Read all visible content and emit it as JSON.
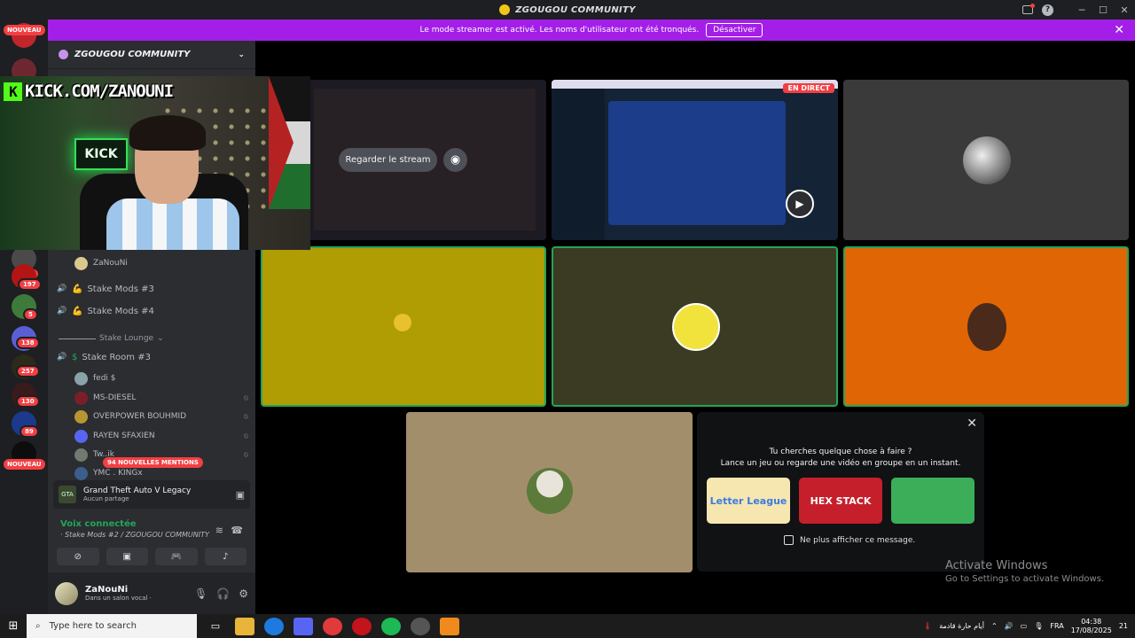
{
  "window": {
    "title": "ZGOUGOU COMMUNITY",
    "minimize": "─",
    "maximize": "☐",
    "close": "✕"
  },
  "banner": {
    "text": "Le mode streamer est activé. Les noms d'utilisateur ont été tronqués.",
    "button": "Désactiver",
    "close": "✕"
  },
  "rail": {
    "new_top": "NOUVEAU",
    "new_bottom": "NOUVEAU",
    "badges": [
      "9",
      "197",
      "5",
      "138",
      "257",
      "130",
      "89"
    ]
  },
  "sidebar": {
    "server_name": "ZGOUGOU COMMUNITY",
    "channels": [
      {
        "name": "Stake Mods #3",
        "emoji": "💪"
      },
      {
        "name": "Stake Mods #4",
        "emoji": "💪"
      }
    ],
    "category": "Stake Lounge",
    "room": {
      "name": "Stake Room #3",
      "prefix": "$"
    },
    "users_top": [
      "ZaNouNi"
    ],
    "users": [
      "fedi $",
      "MS-DIESEL",
      "OVERPOWER BOUHMID",
      "RAYEN SFAXIEN",
      "Tw..ik",
      "YMC . KINGx"
    ],
    "mentions": "94 NOUVELLES MENTIONS"
  },
  "activity": {
    "game": "Grand Theft Auto V Legacy",
    "sub": "Aucun partage",
    "icon": "GTA"
  },
  "voice": {
    "status": "Voix connectée",
    "location": "· Stake Mods #2 / ZGOUGOU COMMUNITY"
  },
  "user_panel": {
    "name": "ZaNouNi",
    "status": "Dans un salon vocal ·"
  },
  "cam": {
    "tag": "KICK.COM/ZANOUNI",
    "kick_sign": "KICK"
  },
  "stage": {
    "watch_label": "Regarder le stream",
    "live_label": "EN DIRECT"
  },
  "suggestion": {
    "line1": "Tu cherches quelque chose à faire ?",
    "line2": "Lance un jeu ou regarde une vidéo en groupe en un instant.",
    "cards": [
      "Letter League",
      "HEX STACK",
      ""
    ],
    "checkbox": "Ne plus afficher ce message."
  },
  "activate": {
    "title": "Activate Windows",
    "sub": "Go to Settings to activate Windows."
  },
  "taskbar": {
    "search_placeholder": "Type here to search",
    "weather": "أيام حارة قادمة",
    "lang": "FRA",
    "time": "04:38",
    "date": "17/08/2025",
    "notifications": "21"
  },
  "colors": {
    "streamer_banner": "#a31fe8",
    "speaking": "#23a55a",
    "tile_yellow": "#b09c03",
    "tile_olive": "#3b3a22",
    "tile_orange": "#e06505",
    "tile_tan": "#a38e6b"
  }
}
